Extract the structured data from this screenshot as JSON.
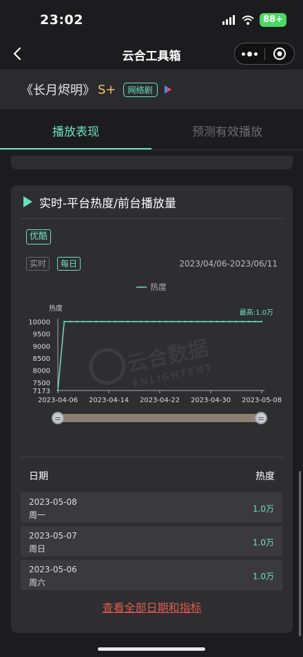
{
  "status": {
    "time": "23:02",
    "battery": "88+"
  },
  "nav": {
    "title": "云合工具箱"
  },
  "show": {
    "title": "《长月烬明》",
    "grade": "S+",
    "type": "网络剧"
  },
  "tabs": [
    {
      "label": "播放表现",
      "active": true
    },
    {
      "label": "预测有效播放",
      "active": false
    }
  ],
  "card": {
    "title": "实时-平台热度/前台播放量",
    "platform": "优酷",
    "modes": {
      "realtime": "实时",
      "daily": "每日"
    },
    "date_range": "2023/04/06-2023/06/11"
  },
  "chart_data": {
    "type": "line",
    "legend": "热度",
    "ylabel": "热度",
    "max_label": "最高:1.0万",
    "y_ticks": [
      7173,
      7500,
      8000,
      8500,
      9000,
      9500,
      10000
    ],
    "ylim": [
      7173,
      10000
    ],
    "x_tick_labels": [
      "2023-04-06",
      "2023-04-14",
      "2023-04-22",
      "2023-04-30",
      "2023-05-08"
    ],
    "x_start": "2023-04-06",
    "x_end": "2023-05-08",
    "x": [
      "2023-04-06",
      "2023-04-07",
      "2023-04-08",
      "2023-04-09",
      "2023-04-10",
      "2023-04-11",
      "2023-04-12",
      "2023-04-13",
      "2023-04-14",
      "2023-04-15",
      "2023-04-16",
      "2023-04-17",
      "2023-04-18",
      "2023-04-19",
      "2023-04-20",
      "2023-04-21",
      "2023-04-22",
      "2023-04-23",
      "2023-04-24",
      "2023-04-25",
      "2023-04-26",
      "2023-04-27",
      "2023-04-28",
      "2023-04-29",
      "2023-04-30",
      "2023-05-01",
      "2023-05-02",
      "2023-05-03",
      "2023-05-04",
      "2023-05-05",
      "2023-05-06",
      "2023-05-07",
      "2023-05-08"
    ],
    "values": [
      7173,
      10000,
      10000,
      10000,
      10000,
      10000,
      10000,
      10000,
      10000,
      10000,
      10000,
      10000,
      10000,
      10000,
      10000,
      10000,
      10000,
      10000,
      10000,
      10000,
      10000,
      10000,
      10000,
      10000,
      10000,
      10000,
      10000,
      10000,
      10000,
      10000,
      10000,
      10000,
      10000
    ],
    "line_color": "#6ee0c0",
    "watermark": "云合数据 ENLIGHTENT"
  },
  "table": {
    "headers": {
      "date": "日期",
      "metric": "热度"
    },
    "rows": [
      {
        "date": "2023-05-08",
        "weekday": "周一",
        "value": "1.0万"
      },
      {
        "date": "2023-05-07",
        "weekday": "周日",
        "value": "1.0万"
      },
      {
        "date": "2023-05-06",
        "weekday": "周六",
        "value": "1.0万"
      }
    ]
  },
  "view_all": "查看全部日期和指标"
}
